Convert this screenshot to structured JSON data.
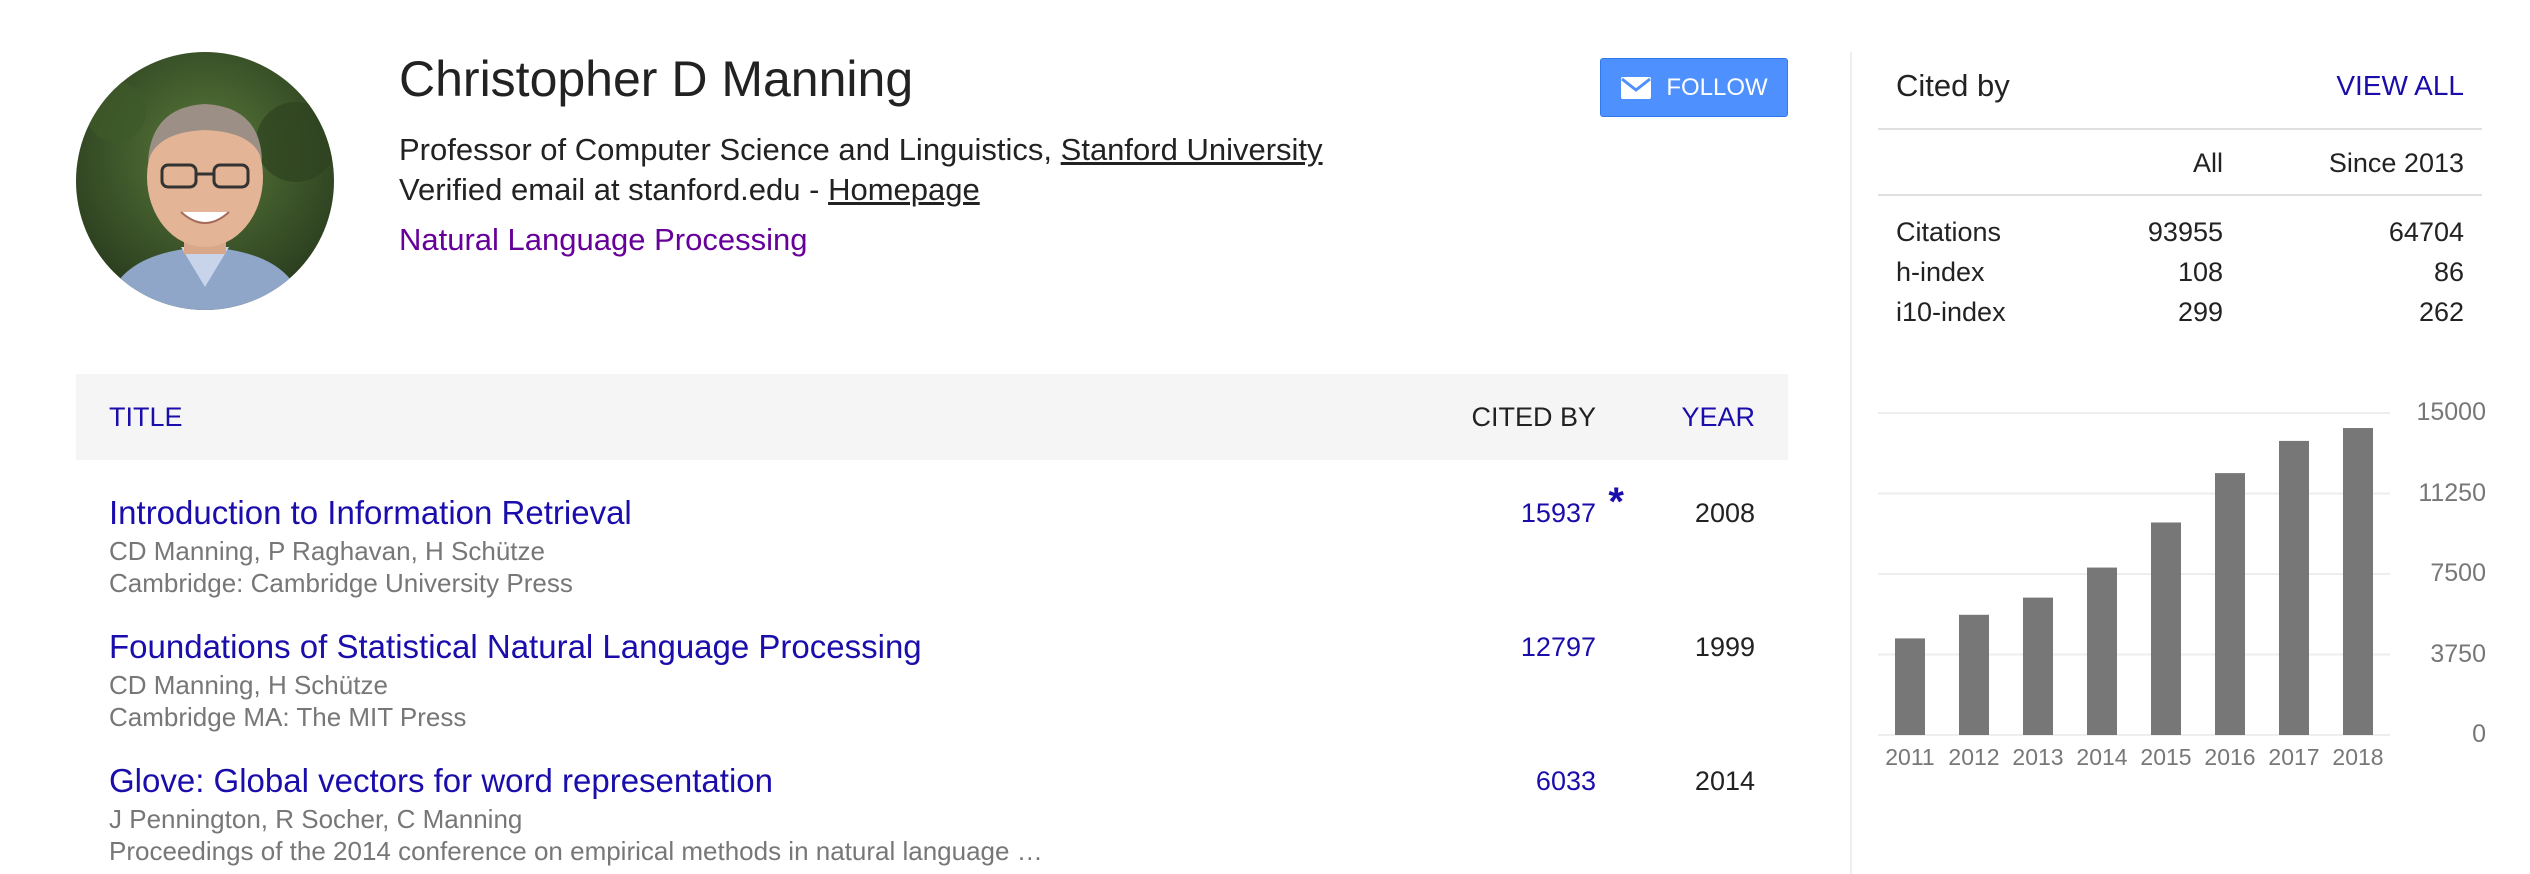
{
  "profile": {
    "name": "Christopher D Manning",
    "affiliation_prefix": "Professor of Computer Science and Linguistics, ",
    "affiliation_link": "Stanford University",
    "email_prefix": "Verified email at stanford.edu - ",
    "homepage_label": "Homepage",
    "interest": "Natural Language Processing"
  },
  "follow_label": "FOLLOW",
  "table": {
    "col_title": "TITLE",
    "col_cited": "CITED BY",
    "col_year": "YEAR",
    "rows": [
      {
        "title": "Introduction to Information Retrieval",
        "authors": "CD Manning, P Raghavan, H Schütze",
        "venue": "Cambridge: Cambridge University Press",
        "cited": "15937",
        "star": "*",
        "year": "2008"
      },
      {
        "title": "Foundations of Statistical Natural Language Processing",
        "authors": "CD Manning, H Schütze",
        "venue": "Cambridge MA: The MIT Press",
        "cited": "12797",
        "star": "",
        "year": "1999"
      },
      {
        "title": "Glove: Global vectors for word representation",
        "authors": "J Pennington, R Socher, C Manning",
        "venue": "Proceedings of the 2014 conference on empirical methods in natural language …",
        "cited": "6033",
        "star": "",
        "year": "2014"
      }
    ]
  },
  "cited_by": {
    "title": "Cited by",
    "view_all": "VIEW ALL",
    "col_all": "All",
    "col_since": "Since 2013",
    "metrics": [
      {
        "label": "Citations",
        "all": "93955",
        "since": "64704"
      },
      {
        "label": "h-index",
        "all": "108",
        "since": "86"
      },
      {
        "label": "i10-index",
        "all": "299",
        "since": "262"
      }
    ]
  },
  "colors": {
    "link": "#1a0dab",
    "interest": "#660099",
    "button": "#4d90fe",
    "bar": "#777777"
  },
  "chart_data": {
    "type": "bar",
    "categories": [
      "2011",
      "2012",
      "2013",
      "2014",
      "2015",
      "2016",
      "2017",
      "2018"
    ],
    "values": [
      4500,
      5600,
      6400,
      7800,
      9900,
      12200,
      13700,
      14300
    ],
    "ylim": [
      0,
      15000
    ],
    "yticks": [
      "0",
      "3750",
      "7500",
      "11250",
      "15000"
    ],
    "grid": true
  }
}
